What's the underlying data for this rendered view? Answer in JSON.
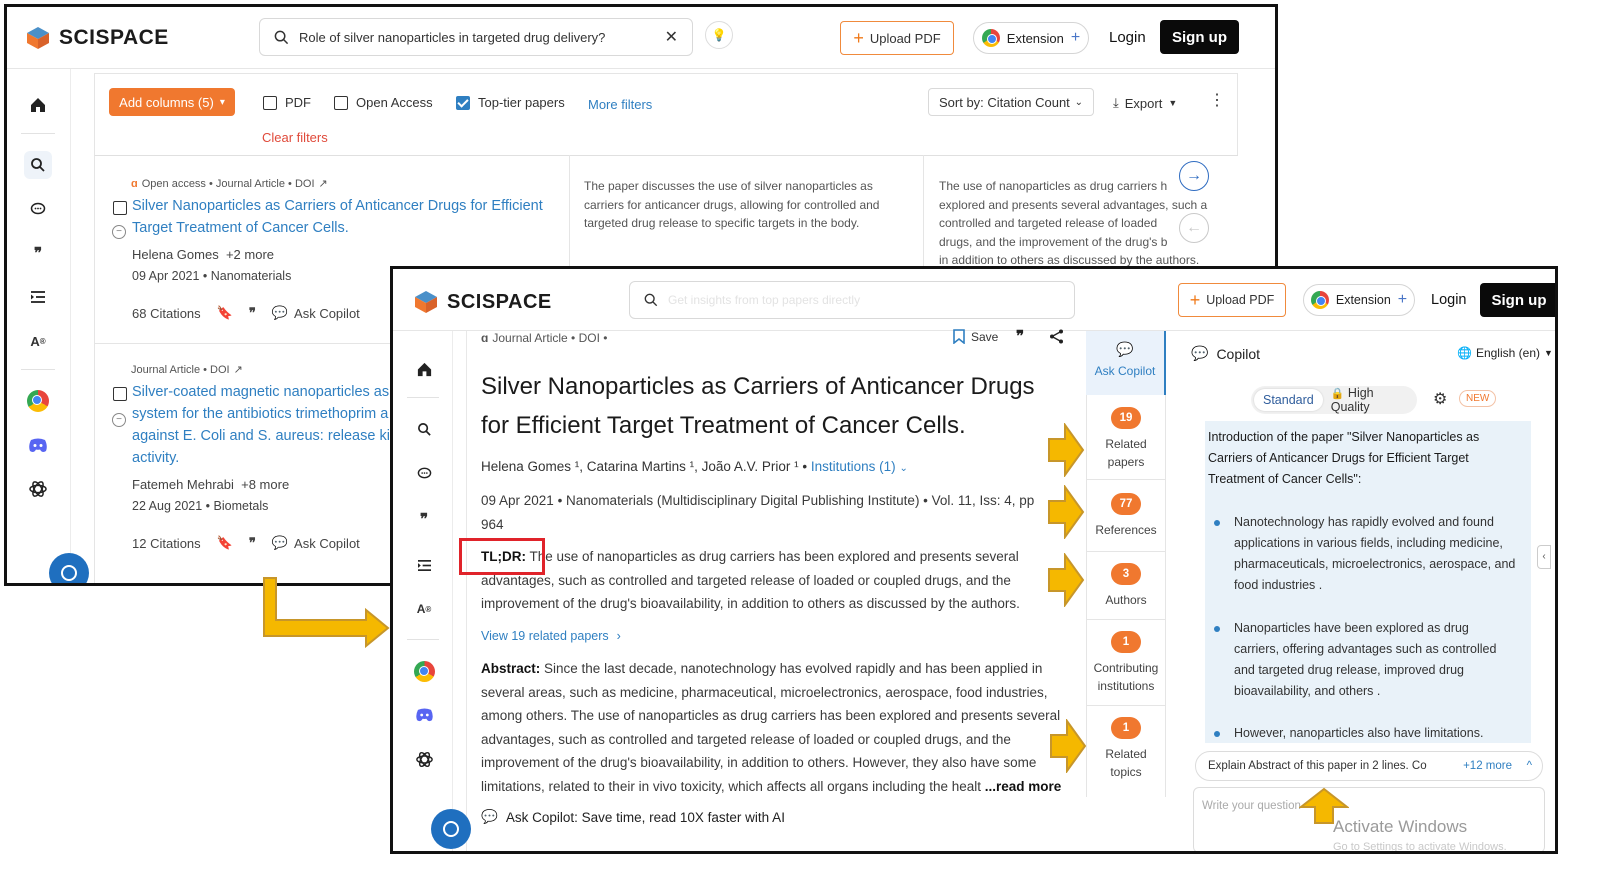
{
  "brand": {
    "name": "SCISPACE"
  },
  "back": {
    "search": {
      "query": "Role of silver nanoparticles in targeted drug delivery?"
    },
    "header": {
      "upload": "Upload PDF",
      "extension": "Extension",
      "login": "Login",
      "signup": "Sign up"
    },
    "toolbar": {
      "add_columns": "Add columns (5)",
      "filters": [
        "PDF",
        "Open Access",
        "Top-tier papers"
      ],
      "more_filters": "More filters",
      "clear_filters": "Clear filters",
      "sort": "Sort by: Citation Count",
      "export": "Export"
    },
    "results": [
      {
        "meta": "Open access • Journal Article • DOI",
        "title_lines": [
          "Silver Nanoparticles as Carriers of Anticancer Drugs for Efficient",
          "Target Treatment of Cancer Cells."
        ],
        "authors": "Helena Gomes",
        "authors_more": "+2 more",
        "date": "09 Apr 2021 • Nanomaterials",
        "citations": "68 Citations",
        "ask": "Ask Copilot",
        "col2_lines": [
          "The paper discusses the use of silver nanoparticles as",
          "carriers for anticancer drugs, allowing for controlled and",
          "targeted drug release to specific targets in the body."
        ],
        "col3_lines": [
          "The use of nanoparticles as drug carriers h",
          "explored and presents several advantages, such a",
          "controlled and targeted release of loaded",
          "drugs, and the improvement of the drug's b",
          "in addition to others as discussed by the authors."
        ]
      },
      {
        "meta": "Journal Article • DOI",
        "title_lines": [
          "Silver-coated magnetic nanoparticles as",
          "system for the antibiotics trimethoprim a",
          "against E. Coli and S. aureus: release ki",
          "activity."
        ],
        "authors": "Fatemeh Mehrabi",
        "authors_more": "+8 more",
        "date": "22 Aug 2021 • Biometals",
        "citations": "12 Citations",
        "ask": "Ask Copilot"
      }
    ]
  },
  "front": {
    "search": {
      "placeholder": "Get insights from top papers directly"
    },
    "header": {
      "upload": "Upload PDF",
      "extension": "Extension",
      "login": "Login",
      "signup": "Sign up"
    },
    "paper": {
      "meta": "Journal Article • DOI •",
      "save": "Save",
      "title_lines": [
        "Silver Nanoparticles as Carriers of Anticancer Drugs",
        "for Efficient Target Treatment of Cancer Cells."
      ],
      "authors": "Helena Gomes ¹, Catarina Martins ¹, João A.V. Prior ¹ •",
      "institutions": "Institutions (1)",
      "pub_lines": [
        "09 Apr 2021 • Nanomaterials (Multidisciplinary Digital Publishing Institute) • Vol. 11, Iss: 4, pp",
        "964"
      ],
      "tldr_label": "TL;DR:",
      "tldr_lines": [
        "The use of nanoparticles as drug carriers has been explored and presents several",
        "advantages, such as controlled and targeted release of loaded or coupled drugs, and the",
        "improvement of the drug's bioavailability, in addition to others as discussed by the authors."
      ],
      "related_link": "View 19 related papers",
      "abstract_label": "Abstract:",
      "abstract_lines": [
        "Since the last decade, nanotechnology has evolved rapidly and has been applied in",
        "several areas, such as medicine, pharmaceutical, microelectronics, aerospace, food industries,",
        "among others. The use of nanoparticles as drug carriers has been explored and presents several",
        "advantages, such as controlled and targeted release of loaded or coupled drugs, and the",
        "improvement of the drug's bioavailability, in addition to others. However, they also have some",
        "limitations, related to their in vivo toxicity, which affects all organs including the healt"
      ],
      "read_more": "...read more",
      "ask_copilot_banner": "Ask Copilot: Save time, read 10X faster with AI"
    },
    "stats": {
      "ask_copilot": "Ask Copilot",
      "items": [
        {
          "count": "19",
          "label_lines": [
            "Related",
            "papers"
          ]
        },
        {
          "count": "77",
          "label_lines": [
            "References"
          ]
        },
        {
          "count": "3",
          "label_lines": [
            "Authors"
          ]
        },
        {
          "count": "1",
          "label_lines": [
            "Contributing",
            "institutions"
          ]
        },
        {
          "count": "1",
          "label_lines": [
            "Related",
            "topics"
          ]
        }
      ]
    },
    "copilot": {
      "title": "Copilot",
      "language": "English (en)",
      "mode_standard": "Standard",
      "mode_hq": "High Quality",
      "new_badge": "NEW",
      "intro_lines": [
        "Introduction of the paper \"Silver Nanoparticles as",
        "Carriers of Anticancer Drugs for Efficient Target",
        "Treatment of Cancer Cells\":"
      ],
      "bullets": [
        [
          "Nanotechnology has rapidly evolved and found",
          "applications in various fields, including medicine,",
          "pharmaceuticals, microelectronics, aerospace, and",
          "food industries ."
        ],
        [
          "Nanoparticles have been explored as drug",
          "carriers, offering advantages such as controlled",
          "and targeted drug release, improved drug",
          "bioavailability, and others ."
        ],
        [
          "However, nanoparticles also have limitations."
        ]
      ],
      "suggestion": "Explain Abstract of this paper in 2 lines. Co",
      "suggestion_more": "+12 more",
      "input_placeholder": "Write your question"
    },
    "watermark": {
      "title": "Activate Windows",
      "sub": "Go to Settings to activate Windows."
    }
  },
  "colors": {
    "accent_orange": "#f0782f",
    "link_blue": "#2f7fc1",
    "highlight_red": "#e0232a",
    "arrow_yellow": "#f5b800",
    "arrow_outline": "#c7962a"
  }
}
